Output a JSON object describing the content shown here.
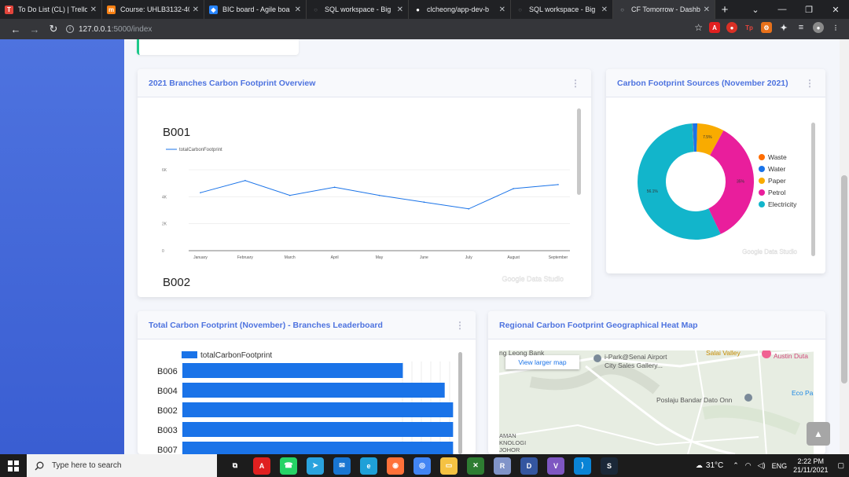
{
  "browser": {
    "tabs": [
      {
        "title": "To Do List (CL) | Trello",
        "icon": "trello-icon",
        "color": "#e2453c",
        "glyph": "T"
      },
      {
        "title": "Course: UHLB3132-40",
        "icon": "moodle-icon",
        "color": "#f98012",
        "glyph": "m"
      },
      {
        "title": "BIC board - Agile boa",
        "icon": "jira-icon",
        "color": "#2684ff",
        "glyph": "◆"
      },
      {
        "title": "SQL workspace - Big",
        "icon": "bigquery-icon",
        "color": "#5f6368",
        "glyph": "○"
      },
      {
        "title": "clcheong/app-dev-b",
        "icon": "github-icon",
        "color": "#ffffff",
        "glyph": "●"
      },
      {
        "title": "SQL workspace - Big",
        "icon": "bigquery-icon",
        "color": "#5f6368",
        "glyph": "○"
      },
      {
        "title": "CF Tomorrow - Dashb",
        "icon": "globe-icon",
        "color": "#9aa0a6",
        "glyph": "○"
      }
    ],
    "new_tab": "+",
    "url_host": "127.0.0.1",
    "url_path": ":5000/index"
  },
  "dashboard": {
    "card1": {
      "title": "2021 Branches Carbon Footprint Overview",
      "kebab": "⋮",
      "watermark": "Google Data Studio"
    },
    "card2": {
      "title": "Carbon Footprint Sources (November 2021)",
      "kebab": "⋮",
      "watermark": "Google Data Studio"
    },
    "card3": {
      "title": "Total Carbon Footprint (November) - Branches Leaderboard",
      "kebab": "⋮"
    },
    "card4": {
      "title": "Regional Carbon Footprint Geographical Heat Map",
      "map": {
        "view_larger": "View larger map",
        "labels": [
          "ng Leong Bank",
          "i-Park@Senai Airport",
          "City Sales Gallery...",
          "Salai Valley",
          "Austin Duta",
          "Eco Pa",
          "Poslaju Bandar Dato Onn",
          "AMAN",
          "KNOLOGI",
          "JOHOR"
        ]
      }
    },
    "scroll_up": "▲"
  },
  "chart_data": [
    {
      "type": "line",
      "title": "B001",
      "series": [
        {
          "name": "totalCarbonFootprint",
          "values": [
            4300,
            5200,
            4100,
            4700,
            4100,
            3600,
            3100,
            4600,
            4900
          ]
        }
      ],
      "categories": [
        "January",
        "February",
        "March",
        "April",
        "May",
        "June",
        "July",
        "August",
        "September"
      ],
      "y_ticks": [
        "0",
        "2K",
        "4K",
        "6K"
      ],
      "ylim": [
        0,
        6000
      ],
      "legend": "top-left",
      "next_chart_title": "B002",
      "color": "#1a73e8"
    },
    {
      "type": "pie",
      "donut": true,
      "slices": [
        {
          "label": "Waste",
          "value": 0.1,
          "color": "#ff6d00"
        },
        {
          "label": "Water",
          "value": 1.3,
          "color": "#1a73e8"
        },
        {
          "label": "Paper",
          "value": 7.5,
          "color": "#f9ab00"
        },
        {
          "label": "Petrol",
          "value": 35.0,
          "color": "#e91e9c"
        },
        {
          "label": "Electricity",
          "value": 56.1,
          "color": "#12b5cb"
        }
      ],
      "data_labels": [
        "7.5%",
        "35%",
        "56.1%"
      ],
      "legend": "right"
    },
    {
      "type": "bar",
      "orientation": "horizontal",
      "series_name": "totalCarbonFootprint",
      "categories": [
        "B006",
        "B004",
        "B002",
        "B003",
        "B007"
      ],
      "values": [
        0.79,
        0.94,
        0.97,
        0.97,
        0.97
      ],
      "color": "#1a73e8"
    }
  ],
  "taskbar": {
    "search_placeholder": "Type here to search",
    "weather": "31°C",
    "language": "ENG",
    "time": "2:22 PM",
    "date": "21/11/2021",
    "apps": [
      {
        "icon": "task-view-icon",
        "color": "#1c1c1c",
        "glyph": "⧉"
      },
      {
        "icon": "acrobat-icon",
        "color": "#e02020",
        "glyph": "A"
      },
      {
        "icon": "whatsapp-icon",
        "color": "#25d366",
        "glyph": "☎"
      },
      {
        "icon": "telegram-icon",
        "color": "#2aa3de",
        "glyph": "➤"
      },
      {
        "icon": "mail-icon",
        "color": "#1976d2",
        "glyph": "✉"
      },
      {
        "icon": "edge-icon",
        "color": "#1fa0d8",
        "glyph": "e"
      },
      {
        "icon": "firefox-icon",
        "color": "#ff7139",
        "glyph": "◉"
      },
      {
        "icon": "chrome-icon",
        "color": "#4285f4",
        "glyph": "◎"
      },
      {
        "icon": "file-explorer-icon",
        "color": "#f5c242",
        "glyph": "▭"
      },
      {
        "icon": "xbox-icon",
        "color": "#2e7d32",
        "glyph": "✕"
      },
      {
        "icon": "r-icon",
        "color": "#8094c9",
        "glyph": "R"
      },
      {
        "icon": "devc-icon",
        "color": "#3456a0",
        "glyph": "D"
      },
      {
        "icon": "visual-studio-icon",
        "color": "#7e57c2",
        "glyph": "V"
      },
      {
        "icon": "vscode-icon",
        "color": "#0a84d6",
        "glyph": "⟩"
      },
      {
        "icon": "steam-icon",
        "color": "#1b2838",
        "glyph": "S"
      }
    ]
  }
}
